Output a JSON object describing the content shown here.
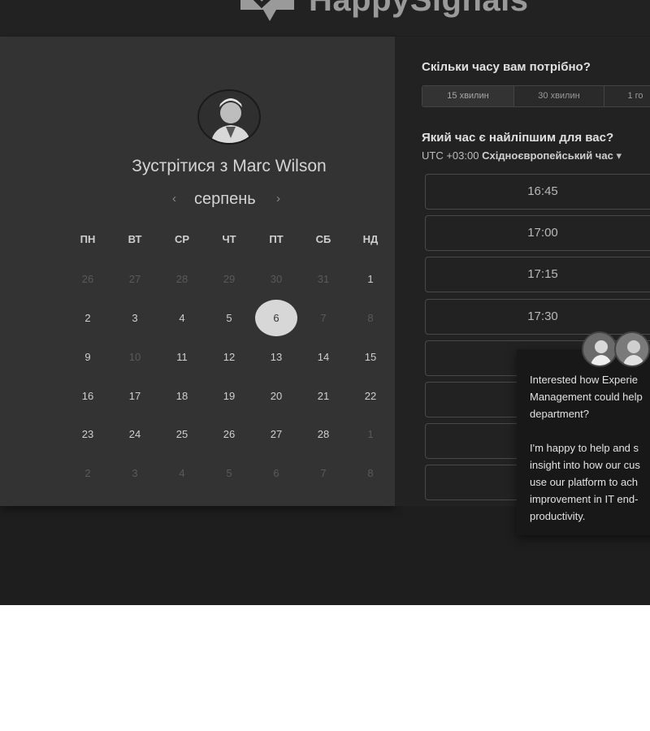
{
  "brand": {
    "name": "HappySignals",
    "logo_icon": "speech-bubble-check-icon"
  },
  "organizer": {
    "title": "Зустрітися з Marc Wilson",
    "avatar_icon": "person-avatar-icon"
  },
  "calendar": {
    "month": "серпень",
    "prev_icon": "chevron-left-icon",
    "next_icon": "chevron-right-icon",
    "weekdays": [
      "ПН",
      "ВТ",
      "СР",
      "ЧТ",
      "ПТ",
      "СБ",
      "НД"
    ],
    "weeks": [
      [
        "26",
        "27",
        "28",
        "29",
        "30",
        "31",
        "1"
      ],
      [
        "2",
        "3",
        "4",
        "5",
        "6",
        "7",
        "8"
      ],
      [
        "9",
        "10",
        "11",
        "12",
        "13",
        "14",
        "15"
      ],
      [
        "16",
        "17",
        "18",
        "19",
        "20",
        "21",
        "22"
      ],
      [
        "23",
        "24",
        "25",
        "26",
        "27",
        "28",
        "1"
      ],
      [
        "2",
        "3",
        "4",
        "5",
        "6",
        "7",
        "8"
      ]
    ],
    "selected": "6"
  },
  "duration": {
    "question": "Скільки часу вам потрібно?",
    "options": [
      "15 хвилин",
      "30 хвилин",
      "1 го"
    ],
    "selected": "15 хвилин"
  },
  "time": {
    "question": "Який час є найліпшим для вас?",
    "timezone_prefix": "UTC +03:00",
    "timezone_name": "Східноєвропейський час",
    "dropdown_icon": "caret-down-icon",
    "slots": [
      "16:45",
      "17:00",
      "17:15",
      "17:30",
      "",
      "",
      ""
    ]
  },
  "chat": {
    "message": "Interested how Experie\nManagement could help\ndepartment?\n\nI'm happy to help and s\ninsight into how our cus\nuse our platform to ach\nimprovement in IT end-\nproductivity."
  },
  "colors": {
    "background": "#1e1e1e",
    "panel_left": "#333333",
    "panel_right": "#222222",
    "selected_day": "#d7d7d7"
  }
}
